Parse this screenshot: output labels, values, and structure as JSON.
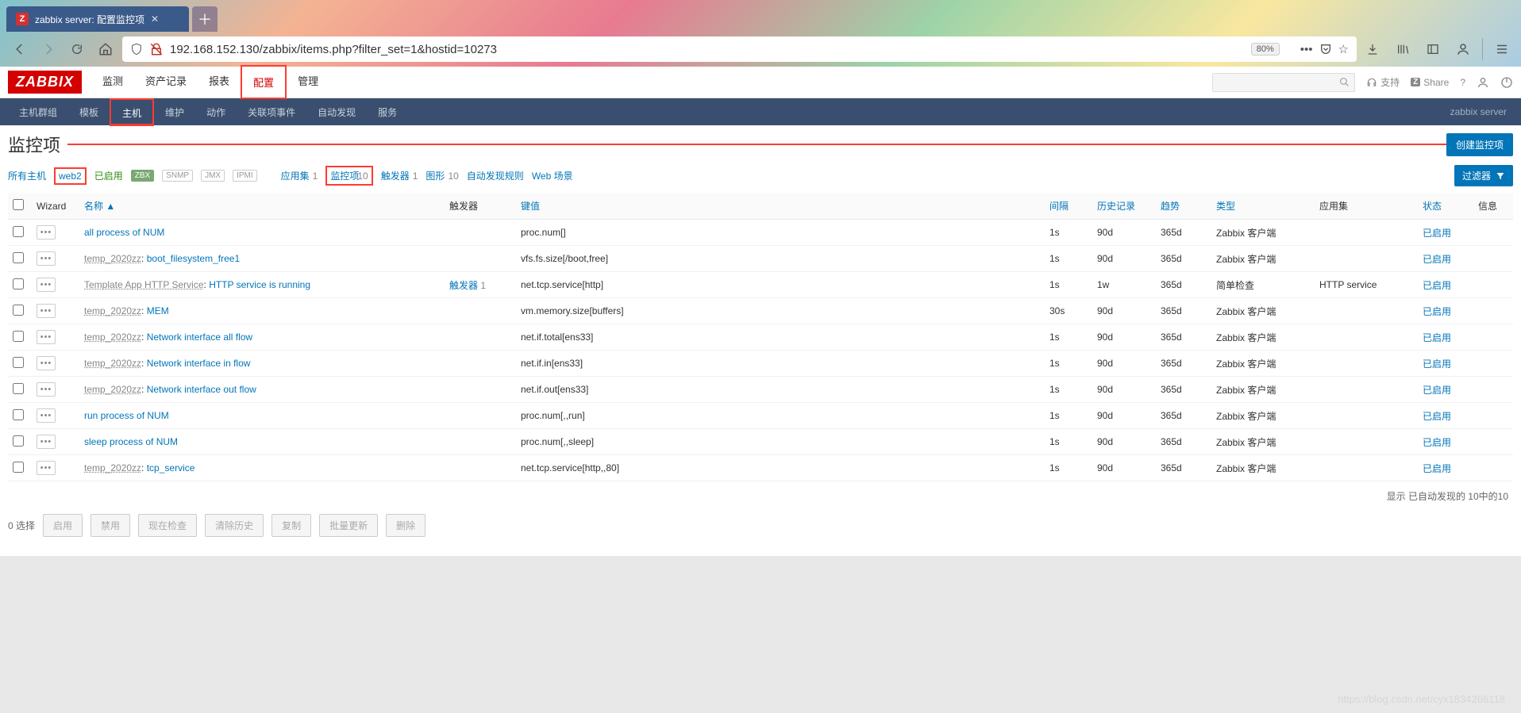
{
  "browser": {
    "tab_title": "zabbix server: 配置监控项",
    "url": "192.168.152.130/zabbix/items.php?filter_set=1&hostid=10273",
    "zoom": "80%"
  },
  "zabbix": {
    "logo": "ZABBIX",
    "nav": [
      "监测",
      "资产记录",
      "报表",
      "配置",
      "管理"
    ],
    "nav_active_index": 3,
    "header_right": {
      "support": "支持",
      "share": "Share"
    },
    "subnav": [
      "主机群组",
      "模板",
      "主机",
      "维护",
      "动作",
      "关联项事件",
      "自动发现",
      "服务"
    ],
    "subnav_active_index": 2,
    "server_label": "zabbix server",
    "page_title": "监控项",
    "create_button": "创建监控项",
    "filter_button": "过滤器",
    "breadcrumb": {
      "all_hosts": "所有主机",
      "host": "web2",
      "enabled": "已启用",
      "badges": [
        "ZBX",
        "SNMP",
        "JMX",
        "IPMI"
      ],
      "apps_label": "应用集",
      "apps_count": "1",
      "items_label": "监控项",
      "items_count": "10",
      "triggers_label": "触发器",
      "triggers_count": "1",
      "graphs_label": "图形",
      "graphs_count": "10",
      "discovery_label": "自动发现规则",
      "web_label": "Web 场景"
    },
    "columns": {
      "wizard": "Wizard",
      "name": "名称",
      "triggers": "触发器",
      "key": "键值",
      "interval": "间隔",
      "history": "历史记录",
      "trends": "趋势",
      "type": "类型",
      "apps": "应用集",
      "status": "状态",
      "info": "信息"
    },
    "rows": [
      {
        "prefix": "",
        "name": "all process of NUM",
        "trigger": "",
        "key": "proc.num[]",
        "interval": "1s",
        "history": "90d",
        "trends": "365d",
        "type": "Zabbix 客户端",
        "apps": "",
        "status": "已启用"
      },
      {
        "prefix": "temp_2020zz",
        "name": "boot_filesystem_free1",
        "trigger": "",
        "key": "vfs.fs.size[/boot,free]",
        "interval": "1s",
        "history": "90d",
        "trends": "365d",
        "type": "Zabbix 客户端",
        "apps": "",
        "status": "已启用"
      },
      {
        "prefix": "Template App HTTP Service",
        "name": "HTTP service is running",
        "trigger": "触发器",
        "trigger_count": "1",
        "key": "net.tcp.service[http]",
        "interval": "1s",
        "history": "1w",
        "trends": "365d",
        "type": "简单检查",
        "apps": "HTTP service",
        "status": "已启用"
      },
      {
        "prefix": "temp_2020zz",
        "name": "MEM",
        "trigger": "",
        "key": "vm.memory.size[buffers]",
        "interval": "30s",
        "history": "90d",
        "trends": "365d",
        "type": "Zabbix 客户端",
        "apps": "",
        "status": "已启用"
      },
      {
        "prefix": "temp_2020zz",
        "name": "Network interface all flow",
        "trigger": "",
        "key": "net.if.total[ens33]",
        "interval": "1s",
        "history": "90d",
        "trends": "365d",
        "type": "Zabbix 客户端",
        "apps": "",
        "status": "已启用"
      },
      {
        "prefix": "temp_2020zz",
        "name": "Network interface in flow",
        "trigger": "",
        "key": "net.if.in[ens33]",
        "interval": "1s",
        "history": "90d",
        "trends": "365d",
        "type": "Zabbix 客户端",
        "apps": "",
        "status": "已启用"
      },
      {
        "prefix": "temp_2020zz",
        "name": "Network interface out flow",
        "trigger": "",
        "key": "net.if.out[ens33]",
        "interval": "1s",
        "history": "90d",
        "trends": "365d",
        "type": "Zabbix 客户端",
        "apps": "",
        "status": "已启用"
      },
      {
        "prefix": "",
        "name": "run process of NUM",
        "trigger": "",
        "key": "proc.num[,,run]",
        "interval": "1s",
        "history": "90d",
        "trends": "365d",
        "type": "Zabbix 客户端",
        "apps": "",
        "status": "已启用"
      },
      {
        "prefix": "",
        "name": "sleep process of NUM",
        "trigger": "",
        "key": "proc.num[,,sleep]",
        "interval": "1s",
        "history": "90d",
        "trends": "365d",
        "type": "Zabbix 客户端",
        "apps": "",
        "status": "已启用"
      },
      {
        "prefix": "temp_2020zz",
        "name": "tcp_service",
        "trigger": "",
        "key": "net.tcp.service[http,,80]",
        "interval": "1s",
        "history": "90d",
        "trends": "365d",
        "type": "Zabbix 客户端",
        "apps": "",
        "status": "已启用"
      }
    ],
    "summary": "显示 已自动发现的 10中的10",
    "footer": {
      "selected": "0 选择",
      "buttons": [
        "启用",
        "禁用",
        "现在检查",
        "清除历史",
        "复制",
        "批量更新",
        "删除"
      ]
    }
  },
  "watermark": "https://blog.csdn.net/cyx1834266118"
}
